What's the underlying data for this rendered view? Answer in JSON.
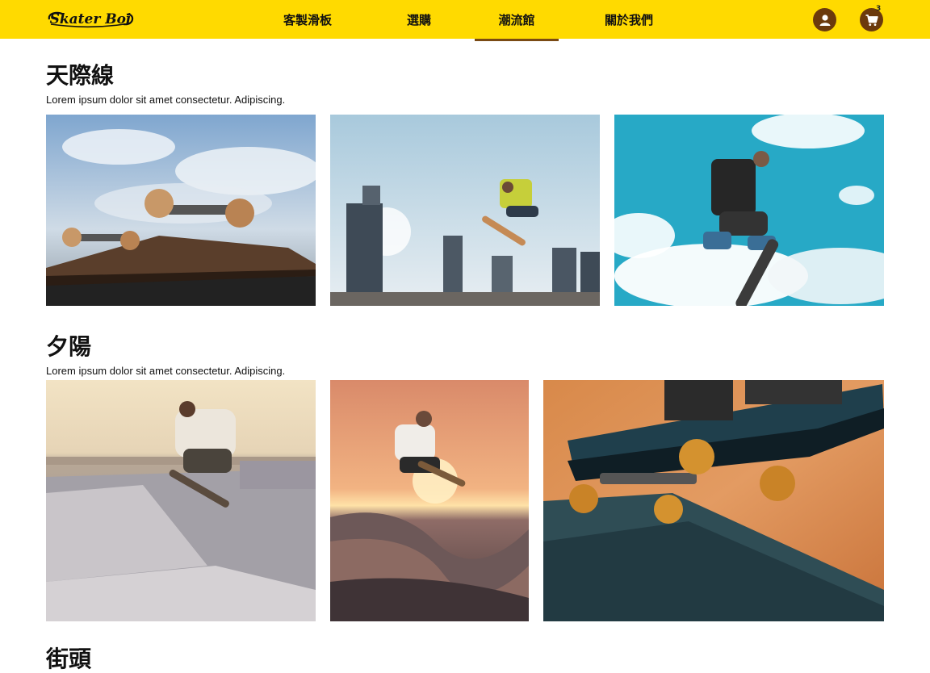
{
  "brand": {
    "logo_text": "Skater Boi"
  },
  "nav": {
    "items": [
      {
        "label": "客製滑板"
      },
      {
        "label": "選購"
      },
      {
        "label": "潮流館",
        "active": true
      },
      {
        "label": "關於我們"
      }
    ]
  },
  "header_icons": {
    "account_icon": "user-icon",
    "cart_icon": "cart-icon",
    "cart_count": "3"
  },
  "colors": {
    "header_bg": "#FFDA00",
    "accent_brown": "#6B3A0C"
  },
  "sections": [
    {
      "title": "天際線",
      "description": "Lorem ipsum dolor sit amet consectetur. Adipiscing.",
      "photos": [
        {
          "subject": "skateboard-closeup-sky"
        },
        {
          "subject": "skater-jump-city-skyline"
        },
        {
          "subject": "skater-jump-blue-sky"
        }
      ]
    },
    {
      "title": "夕陽",
      "description": "Lorem ipsum dolor sit amet consectetur. Adipiscing.",
      "photos": [
        {
          "subject": "skater-trick-skatepark-beach"
        },
        {
          "subject": "skater-jump-sunset-bowl"
        },
        {
          "subject": "skateboard-closeup-sunset"
        }
      ]
    },
    {
      "title": "街頭"
    }
  ]
}
